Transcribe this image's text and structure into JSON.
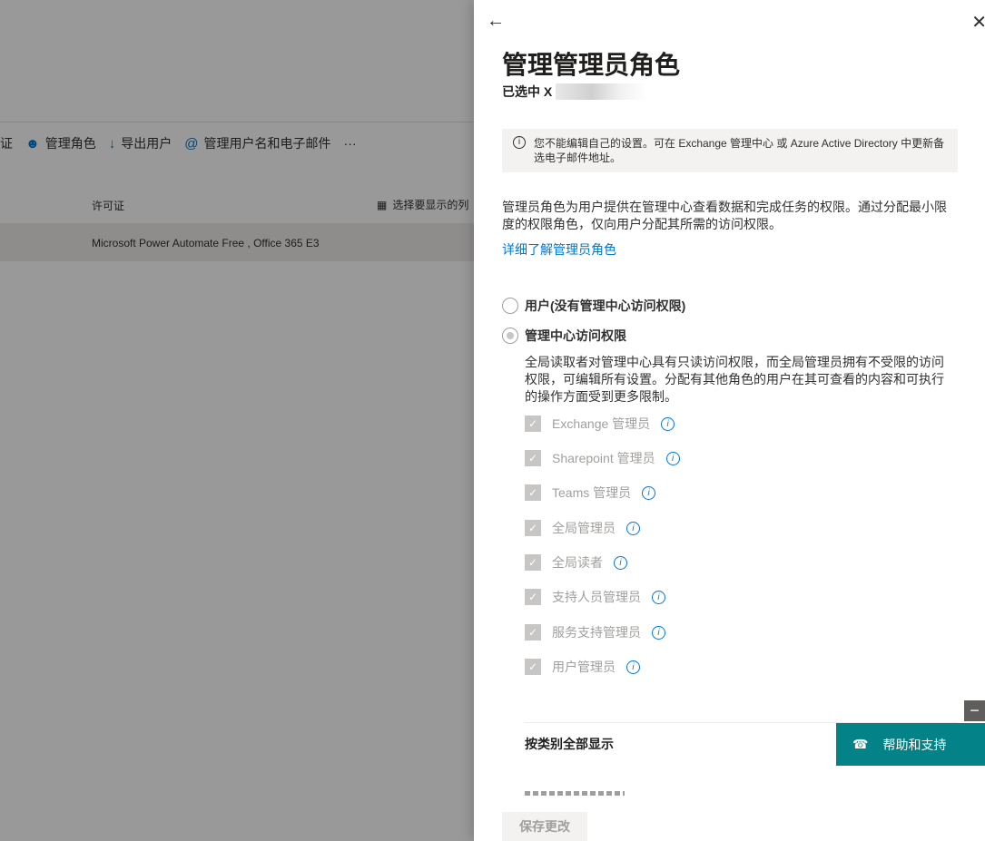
{
  "background": {
    "toolbar": {
      "partial_label": "证",
      "manage_roles": "管理角色",
      "export_users": "导出用户",
      "manage_username_email": "管理用户名和电子邮件",
      "more": "···"
    },
    "table": {
      "license_header": "许可证",
      "choose_columns": "选择要显示的列",
      "row_license": "Microsoft Power Automate Free , Office 365 E3"
    }
  },
  "panel": {
    "title": "管理管理员角色",
    "selected_prefix": "已选中 X",
    "info": "您不能编辑自己的设置。可在 Exchange 管理中心 或 Azure Active Directory 中更新备选电子邮件地址。",
    "description": "管理员角色为用户提供在管理中心查看数据和完成任务的权限。通过分配最小限度的权限角色，仅向用户分配其所需的访问权限。",
    "learn_more": "详细了解管理员角色",
    "radio_user": "用户(没有管理中心访问权限)",
    "radio_admin": "管理中心访问权限",
    "admin_description": "全局读取者对管理中心具有只读访问权限，而全局管理员拥有不受限的访问权限，可编辑所有设置。分配有其他角色的用户在其可查看的内容和可执行的操作方面受到更多限制。",
    "roles": [
      "Exchange 管理员",
      "Sharepoint 管理员",
      "Teams 管理员",
      "全局管理员",
      "全局读者",
      "支持人员管理员",
      "服务支持管理员",
      "用户管理员"
    ],
    "show_all_by_category": "按类别全部显示",
    "help_support": "帮助和支持",
    "save": "保存更改"
  }
}
